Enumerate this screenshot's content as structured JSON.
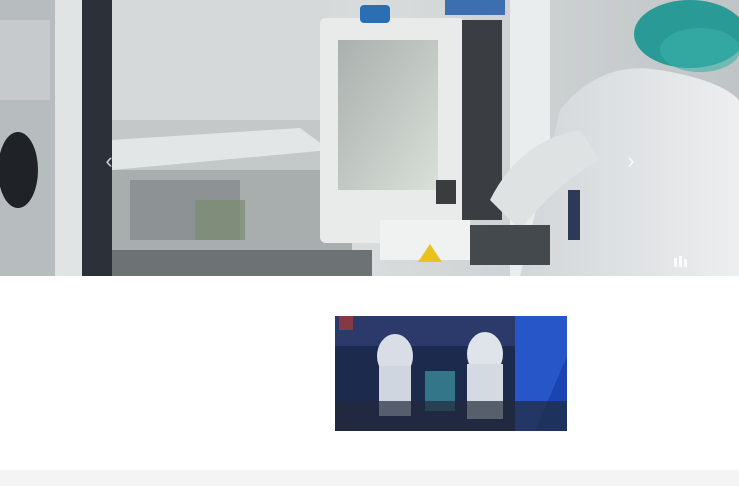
{
  "hero": {
    "prev_symbol": "‹",
    "next_symbol": "›",
    "caption": "",
    "gallery_icon": "gallery-icon"
  },
  "content": {
    "text_lines": [
      "",
      "",
      ""
    ],
    "thumbnail": {
      "caption": "",
      "subcaption": ""
    }
  },
  "colors": {
    "hero_bg": "#cfd4d6",
    "footer_bg": "#f4f4f4",
    "thumb_bg": "#1b2a4a",
    "accent_yellow": "#e8e04a",
    "cap_teal": "#2a9a96"
  }
}
